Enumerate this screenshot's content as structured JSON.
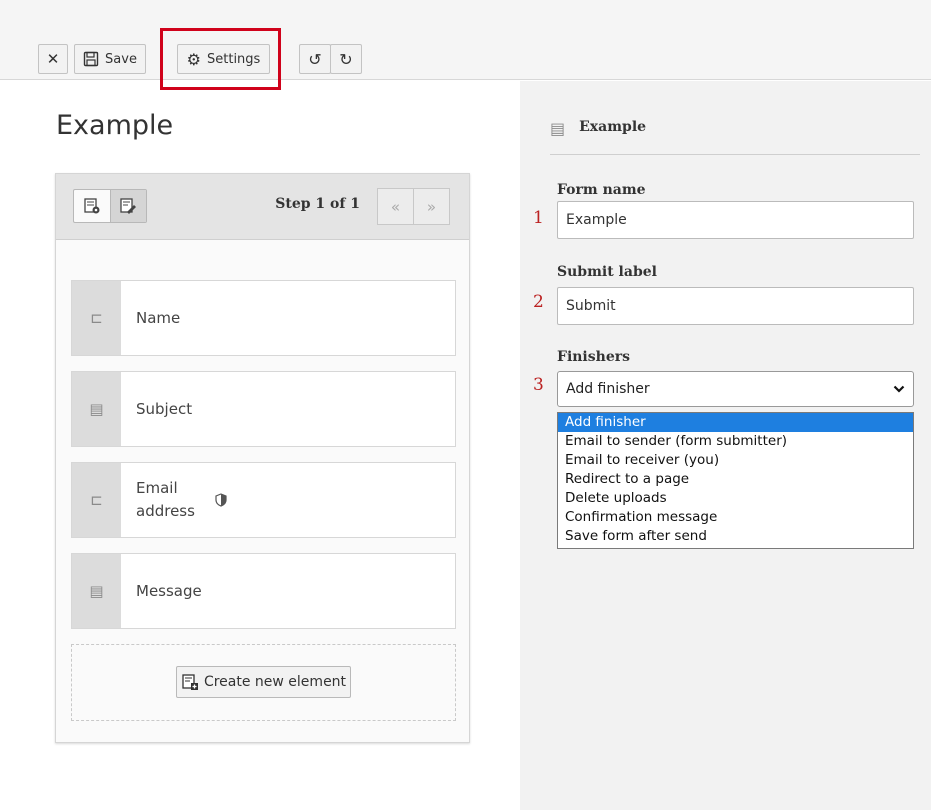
{
  "toolbar": {
    "close_icon": "close-icon",
    "save_label": "Save",
    "settings_label": "Settings",
    "undo_icon": "undo-icon",
    "redo_icon": "redo-icon"
  },
  "stage": {
    "title": "Example",
    "step_label": "Step 1 of 1",
    "pager_prev": "«",
    "pager_next": "»",
    "fields": [
      {
        "label": "Name",
        "icon": "text-field-icon"
      },
      {
        "label": "Subject",
        "icon": "textarea-icon"
      },
      {
        "label": "Email address",
        "icon": "text-field-icon",
        "badge": "shield-icon"
      },
      {
        "label": "Message",
        "icon": "textarea-icon"
      }
    ],
    "create_button_label": "Create new element"
  },
  "inspector": {
    "title": "Example",
    "form_name": {
      "number": "1",
      "label": "Form name",
      "value": "Example"
    },
    "submit_label": {
      "number": "2",
      "label": "Submit label",
      "value": "Submit"
    },
    "finishers": {
      "number": "3",
      "label": "Finishers",
      "selected": "Add finisher",
      "options": [
        "Add finisher",
        "Email to sender (form submitter)",
        "Email to receiver (you)",
        "Redirect to a page",
        "Delete uploads",
        "Confirmation message",
        "Save form after send"
      ]
    }
  },
  "colors": {
    "highlight": "#d0021b",
    "selected_option": "#1e7fe0",
    "annotation_number": "#bb2222"
  }
}
